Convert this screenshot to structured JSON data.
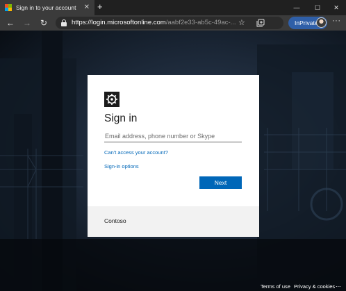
{
  "browser": {
    "tab": {
      "title": "Sign in to your account",
      "close": "✕"
    },
    "new_tab": "+",
    "window_controls": {
      "minimize": "—",
      "maximize": "☐",
      "close": "✕"
    },
    "nav": {
      "back": "←",
      "forward": "→",
      "refresh": "↻"
    },
    "address": {
      "host": "https://login.microsoftonline.com",
      "path": "/aabf2e33-ab5c-49ac-...",
      "favorite_icon": "star-outline-icon",
      "collections_icon": "collections-icon"
    },
    "inprivate_label": "InPrivate",
    "more": "···",
    "logo_colors": [
      "#f25022",
      "#7fba00",
      "#00a4ef",
      "#ffb900"
    ]
  },
  "card": {
    "logo_icon": "organization-logo-icon",
    "title": "Sign in",
    "email_placeholder": "Email address, phone number or Skype",
    "email_value": "",
    "cant_access_link": "Can't access your account?",
    "signin_options_link": "Sign-in options",
    "next_button": "Next",
    "organization_name": "Contoso"
  },
  "footer": {
    "terms": "Terms of use",
    "privacy": "Privacy & cookies",
    "more": "..."
  },
  "colors": {
    "accent": "#0067b8",
    "inprivate": "#2f5fa8",
    "card_footer": "#f2f2f2"
  }
}
